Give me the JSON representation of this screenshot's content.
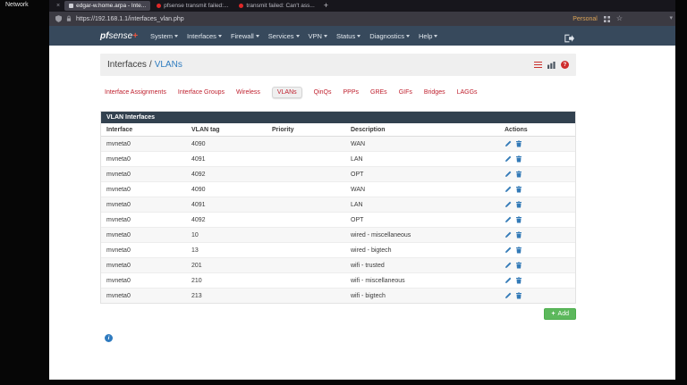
{
  "desktop": {
    "label": "Network"
  },
  "browser": {
    "close_icon": "×",
    "tabs": [
      {
        "title": "edgar-w.home.arpa - Inte..."
      },
      {
        "title": "pfsense transmit failed:..."
      },
      {
        "title": "transmit failed: Can't ass..."
      }
    ],
    "new_tab": "+",
    "url": "https://192.168.1.1/interfaces_vlan.php",
    "container_label": "Personal",
    "star_icon": "☆",
    "overflow_caret": "▾"
  },
  "app": {
    "logo_pf": "pf",
    "logo_sense": "sense",
    "logo_plus": "+",
    "nav_items": [
      "System",
      "Interfaces",
      "Firewall",
      "Services",
      "VPN",
      "Status",
      "Diagnostics",
      "Help"
    ],
    "breadcrumb": {
      "section": "Interfaces",
      "separator": "/",
      "current": "VLANs"
    },
    "help_icon": "?",
    "tabs": [
      "Interface Assignments",
      "Interface Groups",
      "Wireless",
      "VLANs",
      "QinQs",
      "PPPs",
      "GREs",
      "GIFs",
      "Bridges",
      "LAGGs"
    ],
    "active_tab": "VLANs",
    "panel_title": "VLAN Interfaces",
    "columns": [
      "Interface",
      "VLAN tag",
      "Priority",
      "Description",
      "Actions"
    ],
    "rows": [
      {
        "interface": "mvneta0",
        "vlan_tag": "4090",
        "priority": "",
        "description": "WAN"
      },
      {
        "interface": "mvneta0",
        "vlan_tag": "4091",
        "priority": "",
        "description": "LAN"
      },
      {
        "interface": "mvneta0",
        "vlan_tag": "4092",
        "priority": "",
        "description": "OPT"
      },
      {
        "interface": "mvneta0",
        "vlan_tag": "4090",
        "priority": "",
        "description": "WAN"
      },
      {
        "interface": "mvneta0",
        "vlan_tag": "4091",
        "priority": "",
        "description": "LAN"
      },
      {
        "interface": "mvneta0",
        "vlan_tag": "4092",
        "priority": "",
        "description": "OPT"
      },
      {
        "interface": "mvneta0",
        "vlan_tag": "10",
        "priority": "",
        "description": "wired - miscellaneous"
      },
      {
        "interface": "mvneta0",
        "vlan_tag": "13",
        "priority": "",
        "description": "wired - bigtech"
      },
      {
        "interface": "mvneta0",
        "vlan_tag": "201",
        "priority": "",
        "description": "wifi - trusted"
      },
      {
        "interface": "mvneta0",
        "vlan_tag": "210",
        "priority": "",
        "description": "wifi - miscellaneous"
      },
      {
        "interface": "mvneta0",
        "vlan_tag": "213",
        "priority": "",
        "description": "wifi - bigtech"
      }
    ],
    "add_icon": "+",
    "add_button": "Add",
    "info_icon": "i"
  },
  "colors": {
    "navbar": "#37495c",
    "panel_header": "#32414f",
    "tab_link_red": "#bf1f2d",
    "breadcrumb_blue": "#2d7bbf",
    "add_green": "#5cb85c",
    "action_blue": "#337ab7",
    "container_orange": "#dba356",
    "error_favicon_red": "#e02828"
  }
}
